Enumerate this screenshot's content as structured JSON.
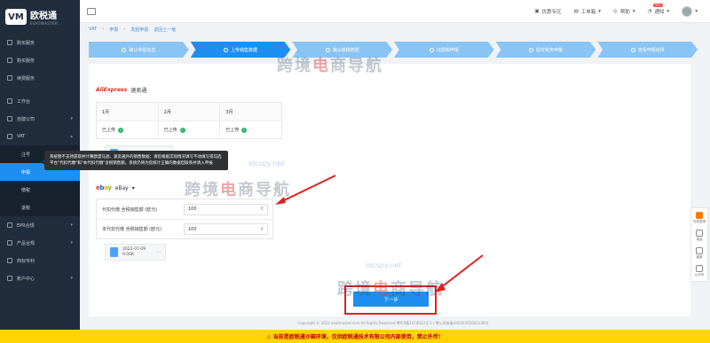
{
  "logo": {
    "mark": "VM",
    "name": "欧税通",
    "sub": "EVATMASTER"
  },
  "sidebar": {
    "items": [
      {
        "label": "购买服务"
      },
      {
        "label": "购买服务"
      },
      {
        "label": "续费服务"
      },
      {
        "label": "工作台"
      },
      {
        "label": "自建公司"
      },
      {
        "label": "VAT"
      },
      {
        "label": "注号"
      },
      {
        "label": "申报"
      },
      {
        "label": "缴税"
      },
      {
        "label": "退税"
      },
      {
        "label": "EPR合规"
      },
      {
        "label": "产品合规"
      },
      {
        "label": "商标专利"
      },
      {
        "label": "账户中心"
      }
    ]
  },
  "topbar": {
    "promo": "优惠专区",
    "ticket": "工单箱",
    "help": "帮助",
    "notify": "通知",
    "notify_count": "99+"
  },
  "breadcrumb": [
    "VAT",
    "申报",
    "发起申报",
    "返回上一级"
  ],
  "steps": [
    {
      "label": "确认申报信息"
    },
    {
      "label": "上传销售数据"
    },
    {
      "label": "确认缴税数据"
    },
    {
      "label": "出报税申报"
    },
    {
      "label": "提交税务申报"
    },
    {
      "label": "查看申报结果"
    }
  ],
  "aliexpress": {
    "logo": "AliExpress",
    "label": "速卖通",
    "months": [
      "1月",
      "2月",
      "3月"
    ],
    "status": "已上传"
  },
  "file1": {
    "name": "AL 销售数据2022.01.xls"
  },
  "tooltip": {
    "text": "系统暂不支持获取并计算欧盟马逊、速卖通外的销售数据；请您根据实际情况填写不动填写或勾选平台\"代扣代缴\"和\"本代扣代缴\"含税销售额，系统仍将为您统计正确的数据但联系并请入申报"
  },
  "ebay": {
    "label": "eBay"
  },
  "amounts": [
    {
      "label": "代扣代缴 含税销售额 (欧元)",
      "value": "100",
      "unit": "€"
    },
    {
      "label": "本代扣代缴 含税销售额 (欧元)",
      "value": "100",
      "unit": "€"
    }
  ],
  "file2": {
    "date": "2022-07-09",
    "size": "9.00K"
  },
  "next_button": "下一步",
  "footer": "Copyright © 2022 eoatmaster.com All Rights Reserved 粤ICP备1014033号-1  |  粤公网安备44030302002138号",
  "right_tools": [
    {
      "label": "在线咨询"
    },
    {
      "label": "电话"
    },
    {
      "label": "客服"
    },
    {
      "label": "公众号"
    }
  ],
  "watermark": {
    "text_a": "跨境",
    "text_red": "电",
    "text_b": "商导航",
    "url": "idcspy.net"
  },
  "bottom_banner": "⚠ 当前是欧税通沙箱环境，仅供欧税通技术有限公司内部使用，禁止外传！"
}
